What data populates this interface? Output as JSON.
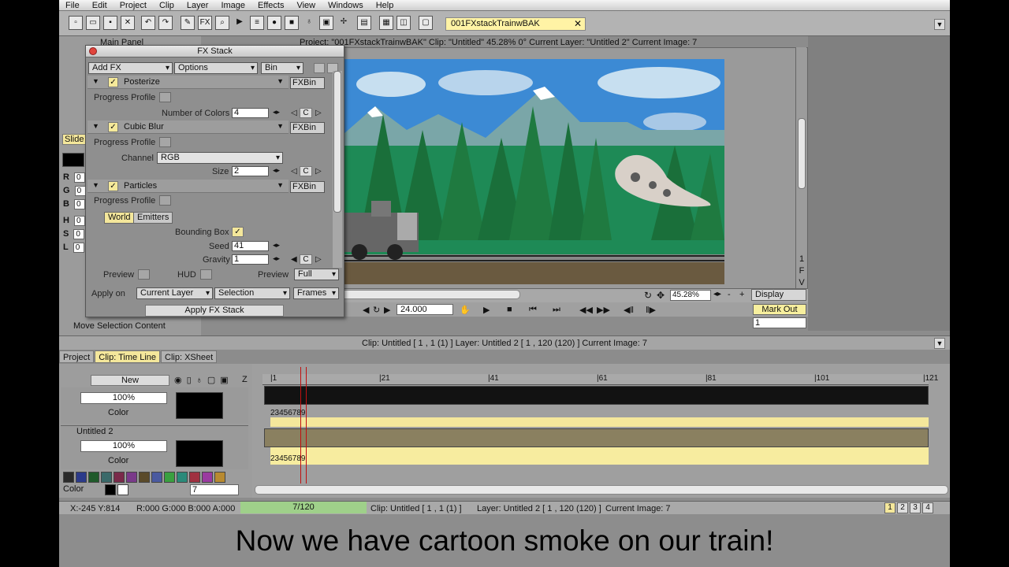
{
  "menu": [
    "File",
    "Edit",
    "Project",
    "Clip",
    "Layer",
    "Image",
    "Effects",
    "View",
    "Windows",
    "Help"
  ],
  "toolbar": {
    "fx_label": "FX",
    "tab_label": "001FXstackTrainwBAK"
  },
  "viewer": {
    "title": "Project: \"001FXstackTrainwBAK\"  Clip: \"Untitled\"  45.28%  0°  Current Layer: \"Untitled 2\"  Current Image: 7",
    "zoom": "45.28%",
    "display": "Display",
    "fps": "24.000",
    "mark_out": "Mark Out",
    "frame": "1",
    "side_letters": [
      "1",
      "F",
      "V"
    ]
  },
  "side_panel": {
    "title": "Main Panel",
    "slide": "Slide",
    "rgb": [
      {
        "k": "R",
        "v": "0"
      },
      {
        "k": "G",
        "v": "0"
      },
      {
        "k": "B",
        "v": "0"
      },
      {
        "k": "H",
        "v": "0"
      },
      {
        "k": "S",
        "v": "0"
      },
      {
        "k": "L",
        "v": "0"
      }
    ],
    "move_sel": "Move Selection Content"
  },
  "fx_stack": {
    "title": "FX Stack",
    "add_fx": "Add FX",
    "options": "Options",
    "bin": "Bin",
    "effects": [
      {
        "name": "Posterize",
        "progress": "Progress Profile",
        "param": "Number of Colors",
        "value": "4",
        "fxbin": "FXBin"
      },
      {
        "name": "Cubic Blur",
        "progress": "Progress Profile",
        "channel_lbl": "Channel",
        "channel": "RGB",
        "param": "Size",
        "value": "2",
        "fxbin": "FXBin"
      },
      {
        "name": "Particles",
        "progress": "Progress Profile",
        "tabs": [
          "World",
          "Emitters"
        ],
        "bbox": "Bounding Box",
        "seed_lbl": "Seed",
        "seed": "41",
        "gravity_lbl": "Gravity",
        "gravity": "1",
        "fxbin": "FXBin"
      }
    ],
    "c": "C",
    "preview": "Preview",
    "hud": "HUD",
    "preview2": "Preview",
    "full": "Full",
    "apply_on": "Apply on",
    "current_layer": "Current Layer",
    "selection": "Selection",
    "frames": "Frames",
    "apply_btn": "Apply FX Stack"
  },
  "info_bar": "Clip: Untitled [ 1 , 1  (1) ]     Layer: Untitled 2 [ 1 , 120  (120) ]   Current Image: 7",
  "tabs": [
    "Project",
    "Clip: Time Line",
    "Clip: XSheet"
  ],
  "timeline": {
    "new_btn": "New",
    "ruler": [
      "1",
      "21",
      "41",
      "61",
      "81",
      "101",
      "121"
    ],
    "layers": [
      {
        "name": "Untitled 2",
        "opacity": "100%",
        "mode": "Color",
        "strip": "23456789"
      },
      {
        "name": "Untitled 2",
        "opacity": "100%",
        "mode": "Color",
        "strip": "23456789"
      }
    ],
    "color_lbl": "Color",
    "color_val": "7",
    "swatch_colors": [
      "#2a2a2a",
      "#2b3a8a",
      "#1f5a2a",
      "#3a6a6a",
      "#7a2a4a",
      "#7a3a8a",
      "#5a4a2a",
      "#4a5aa0",
      "#3aa040",
      "#2a8a7a",
      "#a03040",
      "#9a3aa0",
      "#b88a30"
    ]
  },
  "status": {
    "coords": "X:-245  Y:814",
    "rgba": "R:000 G:000 B:000 A:000",
    "frame": "7/120",
    "clip": "Clip: Untitled [ 1 , 1  (1) ]",
    "layer": "Layer: Untitled 2 [ 1 , 120  (120) ]",
    "image": "Current Image: 7",
    "pages": [
      "1",
      "2",
      "3",
      "4"
    ]
  },
  "caption": "Now we have cartoon smoke on our train!"
}
